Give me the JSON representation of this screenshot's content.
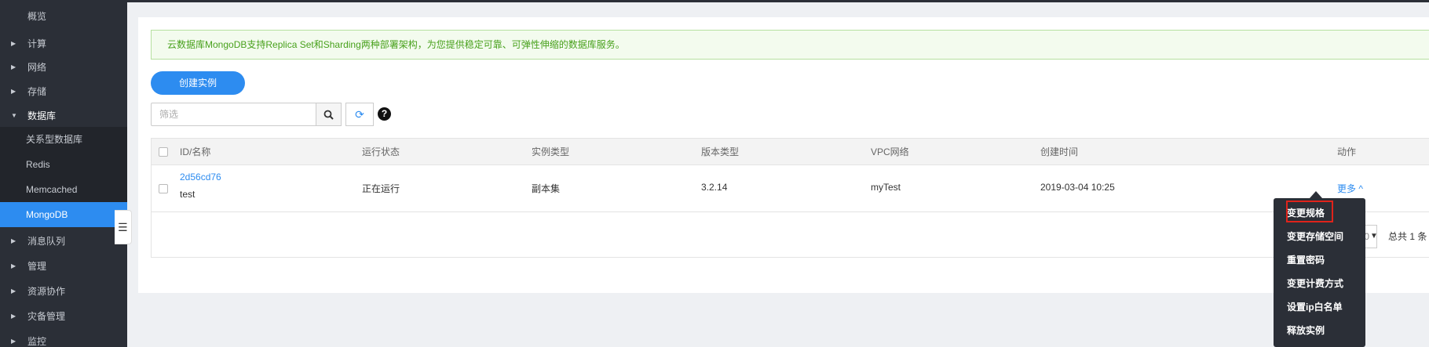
{
  "sidebar": {
    "items": [
      {
        "label": "概览",
        "arrow": ""
      },
      {
        "label": "计算",
        "arrow": "▶"
      },
      {
        "label": "网络",
        "arrow": "▶"
      },
      {
        "label": "存储",
        "arrow": "▶"
      },
      {
        "label": "数据库",
        "arrow": "▼"
      }
    ],
    "sub_items": [
      {
        "label": "关系型数据库"
      },
      {
        "label": "Redis"
      },
      {
        "label": "Memcached"
      },
      {
        "label": "MongoDB"
      }
    ],
    "items_after": [
      {
        "label": "消息队列",
        "arrow": "▶"
      },
      {
        "label": "管理",
        "arrow": "▶"
      },
      {
        "label": "资源协作",
        "arrow": "▶"
      },
      {
        "label": "灾备管理",
        "arrow": "▶"
      },
      {
        "label": "监控",
        "arrow": "▶"
      }
    ],
    "collapse_icon": "☰"
  },
  "notice": {
    "text": "云数据库MongoDB支持Replica Set和Sharding两种部署架构，为您提供稳定可靠、可弹性伸缩的数据库服务。"
  },
  "toolbar": {
    "create_label": "创建实例",
    "filter_placeholder": "筛选",
    "search_icon": "⌕",
    "refresh_icon": "⟳",
    "help_icon": "?"
  },
  "table": {
    "columns": [
      "ID/名称",
      "运行状态",
      "实例类型",
      "版本类型",
      "VPC网络",
      "创建时间",
      "动作"
    ],
    "rows": [
      {
        "id": "2d56cd76",
        "name": "test",
        "status": "正在运行",
        "type": "副本集",
        "version": "3.2.14",
        "vpc": "myTest",
        "created": "2019-03-04 10:25",
        "action": "更多 ^"
      }
    ]
  },
  "pagination": {
    "page_size": "10",
    "caret": "▼",
    "total": "总共 1 条"
  },
  "dropdown": {
    "items": [
      "变更规格",
      "变更存储空间",
      "重置密码",
      "变更计费方式",
      "设置ip白名单",
      "释放实例"
    ]
  },
  "colors": {
    "accent": "#2d8cf0",
    "sidebar_bg": "#2b2f37",
    "notice_text": "#48a11c",
    "highlight": "#e0231b"
  }
}
